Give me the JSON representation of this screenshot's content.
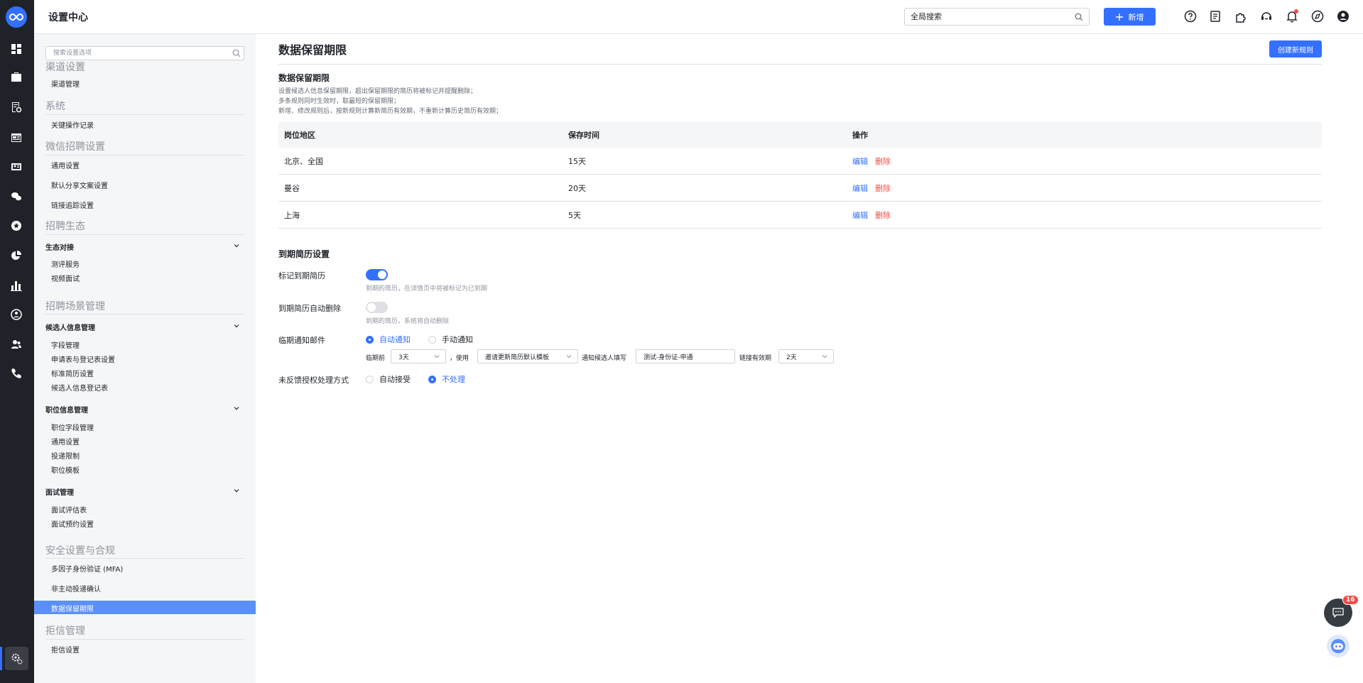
{
  "header": {
    "title": "设置中心",
    "search_placeholder": "全局搜索",
    "new_button": "新增"
  },
  "sidebar": {
    "search_placeholder": "搜索设置选项",
    "groups": {
      "channel": {
        "title": "渠道设置",
        "items": [
          "渠道管理"
        ]
      },
      "system": {
        "title": "系统",
        "items": [
          "关键操作记录"
        ]
      },
      "wechat": {
        "title": "微信招聘设置",
        "items": [
          "通用设置",
          "默认分享文案设置",
          "链接追踪设置"
        ]
      },
      "eco": {
        "title": "招聘生态",
        "sub": "生态对接",
        "items": [
          "测评服务",
          "视频面试"
        ]
      },
      "scene": {
        "title": "招聘场景管理",
        "candidate": {
          "title": "候选人信息管理",
          "items": [
            "字段管理",
            "申请表与登记表设置",
            "标准简历设置",
            "候选人信息登记表"
          ]
        },
        "job": {
          "title": "职位信息管理",
          "items": [
            "职位字段管理",
            "通用设置",
            "投递限制",
            "职位模板"
          ]
        },
        "interview": {
          "title": "面试管理",
          "items": [
            "面试评估表",
            "面试预约设置"
          ]
        }
      },
      "security": {
        "title": "安全设置与合规",
        "items": [
          "多因子身份验证 (MFA)",
          "非主动投递确认",
          "数据保留期限"
        ]
      },
      "reject": {
        "title": "拒信管理",
        "items": [
          "拒信设置"
        ]
      }
    }
  },
  "main": {
    "page_title": "数据保留期限",
    "create_button": "创建新规则",
    "section1_title": "数据保留期限",
    "desc": [
      "设置候选人信息保留期限，超出保留期限的简历将被标记并提醒删除；",
      "多条规则同时生效时，取最短的保留期限；",
      "新增、修改规则后，按新规则计算新简历有效期，不重新计算历史简历有效期；"
    ],
    "table": {
      "headers": [
        "岗位地区",
        "保存时间",
        "操作"
      ],
      "rows": [
        {
          "region": "北京、全国",
          "period": "15天"
        },
        {
          "region": "曼谷",
          "period": "20天"
        },
        {
          "region": "上海",
          "period": "5天"
        }
      ],
      "edit": "编辑",
      "delete": "删除"
    },
    "section2_title": "到期简历设置",
    "mark_label": "标记到期简历",
    "mark_on": true,
    "mark_hint": "到期的简历，在详情页中将被标记为已到期",
    "auto_delete_label": "到期简历自动删除",
    "auto_delete_on": false,
    "auto_delete_hint": "到期的简历，系统将自动删除",
    "notify_label": "临期通知邮件",
    "notify_auto": "自动通知",
    "notify_manual": "手动通知",
    "notify_before": "临期前",
    "notify_before_value": "3天",
    "notify_use": "，使用",
    "notify_template": "邀请更新简历默认模板",
    "notify_fill": "通知候选人填写",
    "notify_form": "测试-身份证-申通",
    "notify_valid": "链接有效期",
    "notify_valid_value": "2天",
    "feedback_label": "未反馈授权处理方式",
    "feedback_accept": "自动接受",
    "feedback_skip": "不处理"
  },
  "floating": {
    "chat_badge": "16"
  },
  "colors": {
    "accent": "#3370ff",
    "danger": "#f54a45",
    "rail": "#1f2329"
  }
}
